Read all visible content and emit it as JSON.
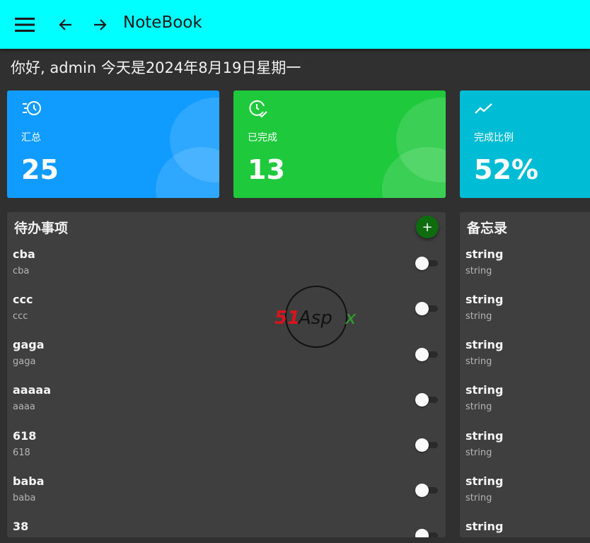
{
  "appbar": {
    "title": "NoteBook",
    "menu_icon": "hamburger-menu-icon",
    "back_icon": "arrow-left-icon",
    "forward_icon": "arrow-right-icon",
    "color": "#00ffff"
  },
  "greeting": "你好, admin 今天是2024年8月19日星期一",
  "cards": [
    {
      "label": "汇总",
      "value": "25",
      "icon": "list-clock-icon",
      "color": "#0f9bff"
    },
    {
      "label": "已完成",
      "value": "13",
      "icon": "clock-check-icon",
      "color": "#1ec93c"
    },
    {
      "label": "完成比例",
      "value": "52%",
      "icon": "trending-up-icon",
      "color": "#00bcd4"
    }
  ],
  "todo": {
    "title": "待办事项",
    "add_label": "+",
    "items": [
      {
        "title": "cba",
        "content": "cba"
      },
      {
        "title": "ccc",
        "content": "ccc"
      },
      {
        "title": "gaga",
        "content": "gaga"
      },
      {
        "title": "aaaaa",
        "content": "aaaa"
      },
      {
        "title": "618",
        "content": "618"
      },
      {
        "title": "baba",
        "content": "baba"
      },
      {
        "title": "38",
        "content": ""
      }
    ]
  },
  "memo": {
    "title": "备忘录",
    "items": [
      {
        "title": "string",
        "content": "string"
      },
      {
        "title": "string",
        "content": "string"
      },
      {
        "title": "string",
        "content": "string"
      },
      {
        "title": "string",
        "content": "string"
      },
      {
        "title": "string",
        "content": "string"
      },
      {
        "title": "string",
        "content": "string"
      },
      {
        "title": "string",
        "content": ""
      }
    ]
  },
  "watermark": {
    "text": "51Aspx"
  }
}
